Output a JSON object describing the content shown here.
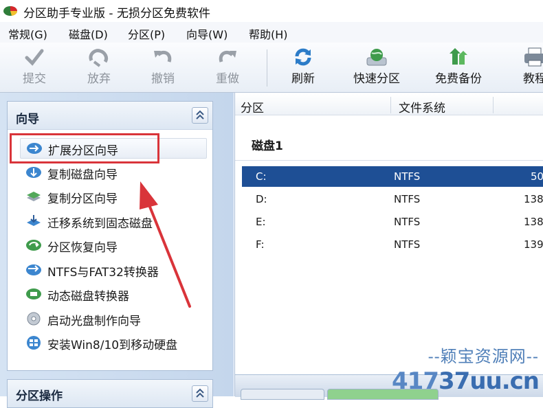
{
  "window": {
    "title": "分区助手专业版 - 无损分区免费软件"
  },
  "menu": [
    "常规(G)",
    "磁盘(D)",
    "分区(P)",
    "向导(W)",
    "帮助(H)"
  ],
  "toolbar": {
    "submit": "提交",
    "discard": "放弃",
    "undo": "撤销",
    "redo": "重做",
    "refresh": "刷新",
    "quick_partition": "快速分区",
    "free_backup": "免费备份",
    "tutorial": "教程"
  },
  "wizard_panel": {
    "title": "向导",
    "items": [
      "扩展分区向导",
      "复制磁盘向导",
      "复制分区向导",
      "迁移系统到固态磁盘",
      "分区恢复向导",
      "NTFS与FAT32转换器",
      "动态磁盘转换器",
      "启动光盘制作向导",
      "安装Win8/10到移动硬盘"
    ]
  },
  "partition_ops_panel": {
    "title": "分区操作"
  },
  "partition_table": {
    "columns": [
      "分区",
      "文件系统"
    ],
    "disk_label": "磁盘1",
    "rows": [
      {
        "partition": "C:",
        "fs": "NTFS",
        "size": "50",
        "selected": true
      },
      {
        "partition": "D:",
        "fs": "NTFS",
        "size": "138",
        "selected": false
      },
      {
        "partition": "E:",
        "fs": "NTFS",
        "size": "138",
        "selected": false
      },
      {
        "partition": "F:",
        "fs": "NTFS",
        "size": "139",
        "selected": false
      }
    ]
  },
  "watermark": {
    "line1": "--颖宝资源网--",
    "line2_num": "417",
    "line2_text": "37uu.cn"
  },
  "colors": {
    "selection": "#1e4f95",
    "highlight_annotation": "#d9343a",
    "panel_border": "#a9bdd6"
  },
  "icons": {
    "submit": "checkmark-icon",
    "discard": "discard-icon",
    "undo": "undo-icon",
    "redo": "redo-icon",
    "refresh": "refresh-icon",
    "quick_partition": "globe-disk-icon",
    "free_backup": "backup-icon",
    "tutorial": "printer-icon"
  }
}
